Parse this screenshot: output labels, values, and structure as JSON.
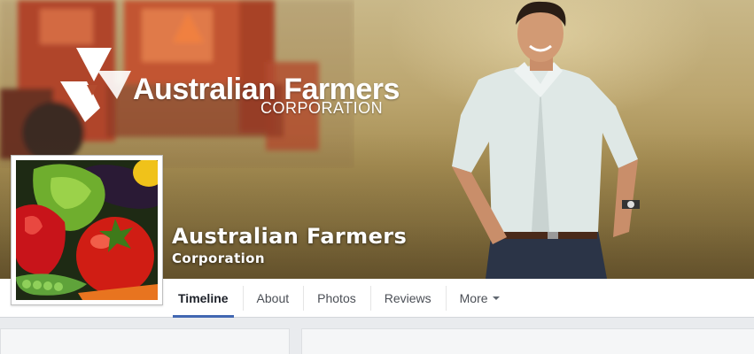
{
  "cover": {
    "logo_text": "Australian Farmers",
    "logo_subtext": "CORPORATION"
  },
  "page": {
    "name": "Australian Farmers",
    "subtitle": "Corporation"
  },
  "tabs": [
    {
      "label": "Timeline",
      "active": true
    },
    {
      "label": "About",
      "active": false
    },
    {
      "label": "Photos",
      "active": false
    },
    {
      "label": "Reviews",
      "active": false
    },
    {
      "label": "More",
      "active": false,
      "dropdown": true
    }
  ],
  "colors": {
    "accent": "#4267b2",
    "nav_bg": "#ffffff",
    "page_bg": "#e9ebee"
  }
}
